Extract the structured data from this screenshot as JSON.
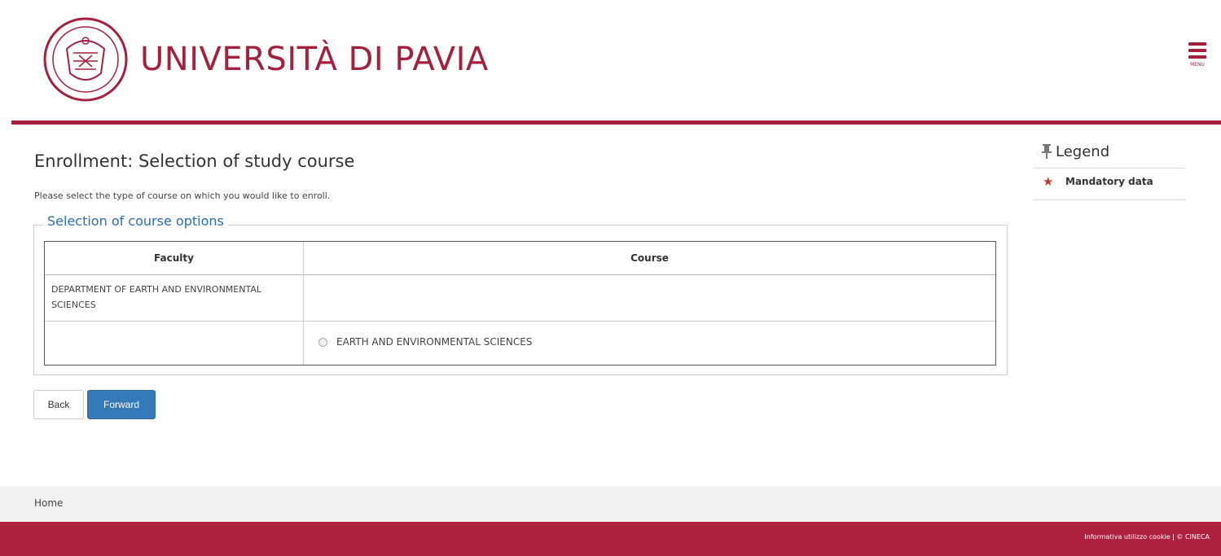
{
  "header": {
    "university_name": "UNIVERSITÀ DI PAVIA",
    "menu_label": "MENU",
    "brand_color": "#a3213f"
  },
  "main": {
    "title": "Enrollment: Selection of study course",
    "description": "Please select the type of course on which you would like to enroll.",
    "fieldset_legend": "Selection of course options",
    "table": {
      "headers": [
        "Faculty",
        "Course"
      ],
      "rows": [
        {
          "faculty": "DEPARTMENT OF EARTH AND ENVIRONMENTAL SCIENCES",
          "course": ""
        },
        {
          "faculty": "",
          "course": "EARTH AND ENVIRONMENTAL SCIENCES"
        }
      ]
    },
    "buttons": {
      "back": "Back",
      "forward": "Forward"
    }
  },
  "sidebar": {
    "legend_title": "Legend",
    "items": [
      {
        "icon": "star-icon",
        "label": "Mandatory data"
      }
    ]
  },
  "footer": {
    "home": "Home",
    "cookie_link": "Informativa utilizzo cookie",
    "separator": "|",
    "copyright": "© CINECA"
  },
  "colors": {
    "accent_blue": "#337ab7",
    "footer_red": "#b0203f",
    "legend_blue": "#2a6fb0"
  }
}
